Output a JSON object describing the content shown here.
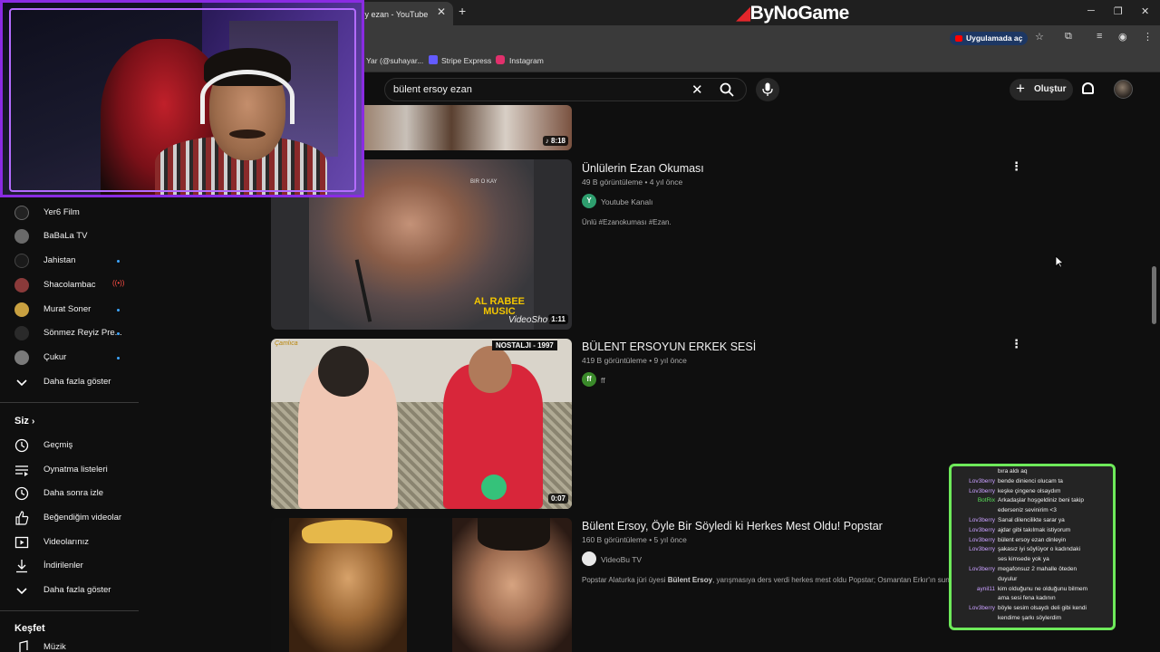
{
  "browser": {
    "tab_title": "ıy ezan - YouTube",
    "tab_close": "✕",
    "new_tab": "+",
    "brand": "ByNoGame",
    "open_in_app": "Uygulamada aç",
    "bookmarks": [
      {
        "label": "Yar (@suhayar...",
        "color": "#555555"
      },
      {
        "label": "Stripe Express",
        "color": "#635bff"
      },
      {
        "label": "Instagram",
        "color": "#e1306c"
      }
    ]
  },
  "header": {
    "search_query": "bülent ersoy ezan",
    "create_label": "Oluştur"
  },
  "sidebar": {
    "subscriptions": [
      {
        "label": "Yer6 Film",
        "color": "#222222",
        "dot": false,
        "live": false
      },
      {
        "label": "BaBaLa TV",
        "color": "#6a6a6a",
        "dot": false,
        "live": false
      },
      {
        "label": "Jahistan",
        "color": "#1a1a1a",
        "dot": true,
        "live": false
      },
      {
        "label": "Shacolambac",
        "color": "#8a3a3a",
        "dot": false,
        "live": true
      },
      {
        "label": "Murat Soner",
        "color": "#c8a040",
        "dot": true,
        "live": false
      },
      {
        "label": "Sönmez Reyiz Pre...",
        "color": "#2a2a2a",
        "dot": true,
        "live": false
      },
      {
        "label": "Çukur",
        "color": "#7a7a7a",
        "dot": true,
        "live": false
      }
    ],
    "show_more_1": "Daha fazla göster",
    "you_heading": "Siz",
    "you_items": [
      {
        "label": "Geçmiş",
        "icon": "history-icon"
      },
      {
        "label": "Oynatma listeleri",
        "icon": "playlist-icon"
      },
      {
        "label": "Daha sonra izle",
        "icon": "watch-later-icon"
      },
      {
        "label": "Beğendiğim videolar",
        "icon": "like-icon"
      },
      {
        "label": "Videolarınız",
        "icon": "your-videos-icon"
      },
      {
        "label": "İndirilenler",
        "icon": "download-icon"
      }
    ],
    "show_more_2": "Daha fazla göster",
    "explore_heading": "Keşfet",
    "explore_first": "Müzik",
    "live_indicator": "((•))"
  },
  "videos": [
    {
      "duration": "8:18"
    },
    {
      "title": "Ünlülerin Ezan Okuması",
      "meta": "49 B görüntüleme • 4 yıl önce",
      "channel": "Youtube Kanalı",
      "channel_initial": "Y",
      "channel_color": "#2e9e6e",
      "description": "Ünlü #Ezanokuması #Ezan.",
      "duration": "1:11",
      "overlay_top": "BIR O KAY",
      "overlay_logo": "AL RABEE MUSIC",
      "overlay_wm": "VideoShow"
    },
    {
      "title": "BÜLENT ERSOYUN ERKEK SESİ",
      "meta": "419 B görüntüleme • 9 yıl önce",
      "channel": "ff",
      "channel_initial": "ff",
      "channel_color": "#3a8a2a",
      "duration": "0:07",
      "overlay_top": "NOSTALJI - 1997",
      "overlay_logo": "Çamlıca"
    },
    {
      "title": "Bülent Ersoy, Öyle Bir Söyledi ki Herkes Mest Oldu! Popstar",
      "meta": "160 B görüntüleme • 5 yıl önce",
      "channel": "VideoBu TV",
      "channel_initial": "",
      "channel_color": "#e8e8e8",
      "description_pre": "Popstar Alaturka jüri üyesi ",
      "description_bold": "Bülent Ersoy",
      "description_post": ", yarışmasıya ders verdi herkes mest oldu Popstar; Osmantan Erkır'ın sunuc"
    }
  ],
  "chat": [
    {
      "user": "",
      "msg": "bıra aldı aq",
      "color": "#c9a0ff"
    },
    {
      "user": "Lov3berry",
      "msg": "bende dinienci olucam ta",
      "color": "#c9a0ff"
    },
    {
      "user": "Lov3berry",
      "msg": "keşke çingene olsaydım",
      "color": "#c9a0ff"
    },
    {
      "user": "BotRix",
      "msg": "Arkadaşlar hoşgeldiniz beni takip",
      "color": "#5adf5a"
    },
    {
      "user": "",
      "msg": "ederseniz sevinirim <3",
      "color": "#5adf5a"
    },
    {
      "user": "Lov3berry",
      "msg": "Sanal dilencilikte sarar ya",
      "color": "#c9a0ff"
    },
    {
      "user": "Lov3berry",
      "msg": "ajdar gibi takılmak istiyorum",
      "color": "#c9a0ff"
    },
    {
      "user": "Lov3berry",
      "msg": "bülent ersoy ezan dinleyin",
      "color": "#c9a0ff"
    },
    {
      "user": "Lov3berry",
      "msg": "şakasız iyi söylüyor o kadındaki",
      "color": "#c9a0ff"
    },
    {
      "user": "",
      "msg": "ses kimsede yok ya",
      "color": "#c9a0ff"
    },
    {
      "user": "Lov3berry",
      "msg": "megafonsuz 2 mahalle öteden",
      "color": "#c9a0ff"
    },
    {
      "user": "",
      "msg": "duyulur",
      "color": "#c9a0ff"
    },
    {
      "user": "aynil11",
      "msg": "kim olduğunu ne olduğunu bilmem",
      "color": "#c9a0ff"
    },
    {
      "user": "",
      "msg": "ama sesi fena kadının",
      "color": "#c9a0ff"
    },
    {
      "user": "Lov3berry",
      "msg": "böyle sesim olsaydı deli gibi kendi",
      "color": "#c9a0ff"
    },
    {
      "user": "",
      "msg": "kendime şarkı söylerdim",
      "color": "#c9a0ff"
    }
  ]
}
